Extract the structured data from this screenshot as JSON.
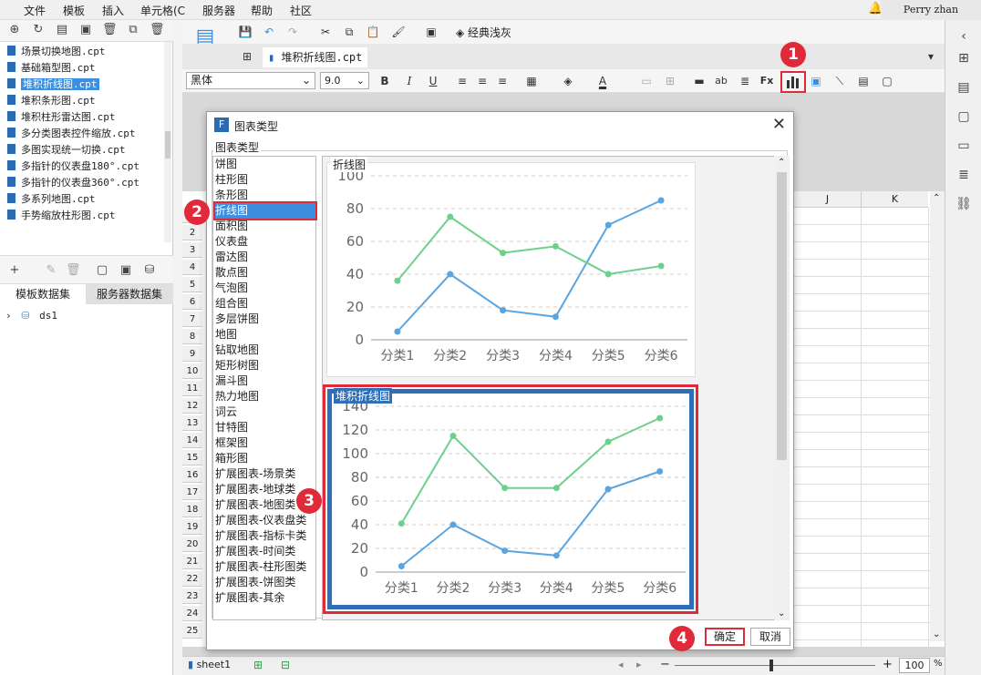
{
  "menubar": {
    "items": [
      "文件",
      "模板",
      "插入",
      "单元格(C",
      "服务器",
      "帮助",
      "社区"
    ],
    "user": "Perry zhan"
  },
  "left_panel": {
    "files": [
      "场景切换地图.cpt",
      "基础箱型图.cpt",
      "堆积折线图.cpt",
      "堆积条形图.cpt",
      "堆积柱形雷达图.cpt",
      "多分类图表控件缩放.cpt",
      "多图实现统一切换.cpt",
      "多指针的仪表盘180°.cpt",
      "多指针的仪表盘360°.cpt",
      "多系列地图.cpt",
      "手势缩放柱形图.cpt"
    ],
    "selected_file_index": 2,
    "tabs": [
      "模板数据集",
      "服务器数据集"
    ],
    "datasource": "ds1"
  },
  "toolbar": {
    "theme_label": "经典浅灰",
    "doc_tab": "堆积折线图.cpt",
    "font_name": "黑体",
    "font_size": "9.0"
  },
  "sheet": {
    "row_numbers": [
      "1",
      "2",
      "3",
      "4",
      "5",
      "6",
      "7",
      "8",
      "9",
      "10",
      "11",
      "12",
      "13",
      "14",
      "15",
      "16",
      "17",
      "18",
      "19",
      "20",
      "21",
      "22",
      "23",
      "24",
      "25"
    ],
    "columns": [
      "J",
      "K"
    ],
    "sheet_tab": "sheet1",
    "zoom": "100",
    "zoom_unit": "%"
  },
  "dialog": {
    "title": "图表类型",
    "group_label": "图表类型",
    "types": [
      "饼图",
      "柱形图",
      "条形图",
      "折线图",
      "面积图",
      "仪表盘",
      "雷达图",
      "散点图",
      "气泡图",
      "组合图",
      "多层饼图",
      "地图",
      "钻取地图",
      "矩形树图",
      "漏斗图",
      "热力地图",
      "词云",
      "甘特图",
      "框架图",
      "箱形图",
      "扩展图表-场景类",
      "扩展图表-地球类",
      "扩展图表-地图类",
      "扩展图表-仪表盘类",
      "扩展图表-指标卡类",
      "扩展图表-时间类",
      "扩展图表-柱形图类",
      "扩展图表-饼图类",
      "扩展图表-其余"
    ],
    "selected_type_index": 3,
    "ok_label": "确定",
    "cancel_label": "取消",
    "badges": [
      "1",
      "2",
      "3",
      "4"
    ]
  },
  "chart_data": [
    {
      "type": "line",
      "title": "折线图",
      "categories": [
        "分类1",
        "分类2",
        "分类3",
        "分类4",
        "分类5",
        "分类6"
      ],
      "series": [
        {
          "values": [
            5,
            40,
            18,
            14,
            70,
            85
          ],
          "color": "#5aa5e0"
        },
        {
          "values": [
            36,
            75,
            53,
            57,
            40,
            45
          ],
          "color": "#6dd08b"
        }
      ],
      "ylim": [
        0,
        100
      ],
      "yticks": [
        "0",
        "20",
        "40",
        "60",
        "80",
        "100"
      ],
      "grid": true
    },
    {
      "type": "line",
      "title": "堆积折线图",
      "categories": [
        "分类1",
        "分类2",
        "分类3",
        "分类4",
        "分类5",
        "分类6"
      ],
      "series": [
        {
          "values": [
            5,
            40,
            18,
            14,
            70,
            85
          ],
          "color": "#5aa5e0"
        },
        {
          "values": [
            41,
            115,
            71,
            71,
            110,
            130
          ],
          "color": "#6dd08b"
        }
      ],
      "ylim": [
        0,
        140
      ],
      "yticks": [
        "0",
        "20",
        "40",
        "60",
        "80",
        "100",
        "120",
        "140"
      ],
      "grid": true
    }
  ]
}
